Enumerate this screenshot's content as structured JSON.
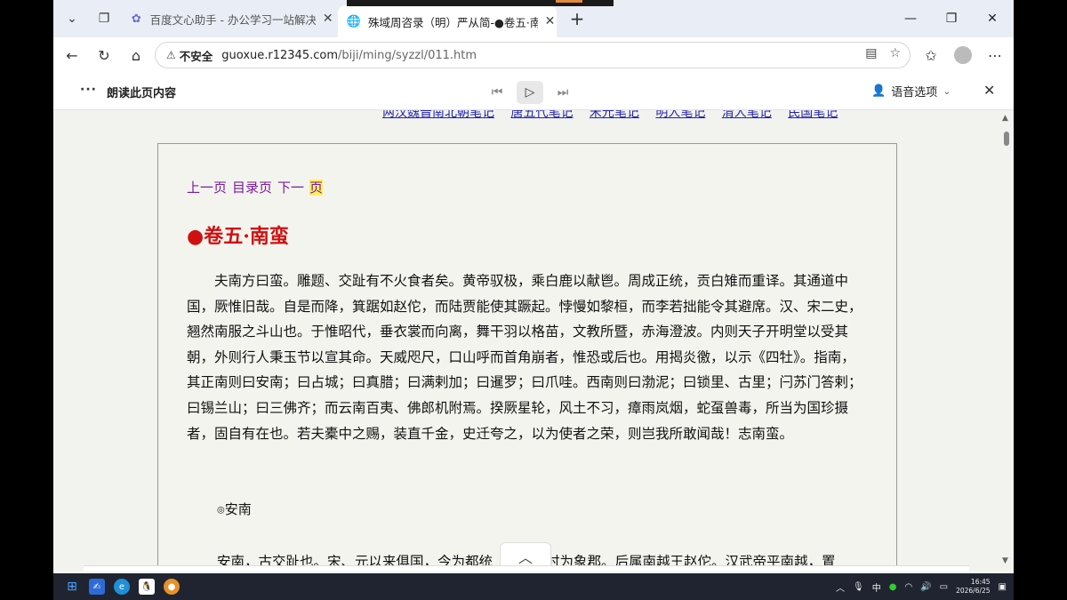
{
  "tabs": [
    {
      "title": "百度文心助手 - 办公学习一站解决",
      "active": false
    },
    {
      "title": "殊域周咨录（明）严从简-●卷五·南",
      "active": true
    }
  ],
  "address": {
    "insecure_label": "不安全",
    "url_host": "guoxue.r12345.com",
    "url_path": "/biji/ming/syzzl/011.htm"
  },
  "readaloud": {
    "more": "···",
    "label": "朗读此页内容",
    "voice_options": "语音选项"
  },
  "page": {
    "top_nav": [
      "两汉魏晋南北朝笔记",
      "唐五代笔记",
      "宋元笔记",
      "明人笔记",
      "清人笔记",
      "民国笔记"
    ],
    "prev": "上一页",
    "toc": "目录页",
    "next_pre": "下一",
    "next_hl": "页",
    "chapter_title": "●卷五·南蛮",
    "paragraph": "夫南方曰蛮。雕题、交趾有不火食者矣。黄帝驭极，乘白鹿以献鬯。周成正统，贡白雉而重译。其通道中国，厥惟旧哉。自是而降，箕踞如赵佗，而陆贾能使其蹶起。悖慢如黎桓，而李若拙能令其避席。汉、宋二史，翘然南服之斗山也。于惟昭代，垂衣裳而向离，舞干羽以格苗，文教所暨，赤海澄波。内则天子开明堂以受其朝，外则行人秉玉节以宣其命。天威咫尺，口山呼而首角崩者，惟恐或后也。用揭炎徼，以示《四牡》。指南，其正南则曰安南；曰占城；曰真腊；曰满剌加；曰暹罗；曰爪哇。西南则曰渤泥；曰锁里、古里；闩苏门答剌；曰锡兰山；曰三佛齐；而云南百夷、佛郎机附焉。揆厥星轮，风土不习，瘴雨岚烟，蛇虿兽毒，所当为国珍摄者，固自有在也。若夫橐中之赐，装直千金，史迁夸之，以为使者之荣，则岂我所敢闻哉！志南蛮。",
    "section_mark": "◎",
    "section_title": "安南",
    "paragraph2_start": "安南，古交趾也。宋、元以来俱国，今为都统",
    "paragraph2_end": "时为象郡。后属南越王赵佗。汉武帝平南越，置"
  },
  "taskbar": {
    "ime": "中",
    "time": "16:45",
    "date": "2026/6/25"
  }
}
